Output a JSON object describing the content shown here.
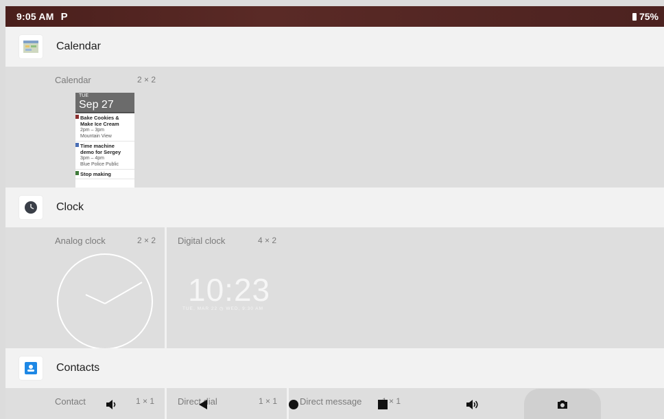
{
  "status_bar": {
    "time": "9:05 AM",
    "notification_icon": "P",
    "battery": "75%"
  },
  "sections": [
    {
      "app": "Calendar",
      "widgets": [
        {
          "name": "Calendar",
          "size": "2 × 2",
          "preview": {
            "day": "TUE",
            "date": "Sep 27",
            "events": [
              {
                "title": "Bake Cookies &",
                "title2": "Make Ice Cream",
                "time": "2pm – 3pm",
                "place": "Mountain View",
                "color": "#8b2f2f"
              },
              {
                "title": "Time machine",
                "title2": "demo for Sergey",
                "time": "3pm – 4pm",
                "place": "Blue Police Public",
                "color": "#4a6fb5"
              },
              {
                "title": "Stop making",
                "title2": "",
                "time": "",
                "place": "",
                "color": "#3f7a3a"
              }
            ]
          }
        }
      ]
    },
    {
      "app": "Clock",
      "widgets": [
        {
          "name": "Analog clock",
          "size": "2 × 2"
        },
        {
          "name": "Digital clock",
          "size": "4 × 2",
          "time": "10:23",
          "subline": "TUE, MAR 22  ◷ WED, 9:30 AM"
        }
      ]
    },
    {
      "app": "Contacts",
      "widgets": [
        {
          "name": "Contact",
          "size": "1 × 1"
        },
        {
          "name": "Direct dial",
          "size": "1 × 1"
        },
        {
          "name": "Direct message",
          "size": "1 × 1"
        }
      ]
    }
  ],
  "nav_icons": [
    "volume-down-icon",
    "back-icon",
    "home-icon",
    "recents-icon",
    "volume-up-icon",
    "camera-icon"
  ]
}
